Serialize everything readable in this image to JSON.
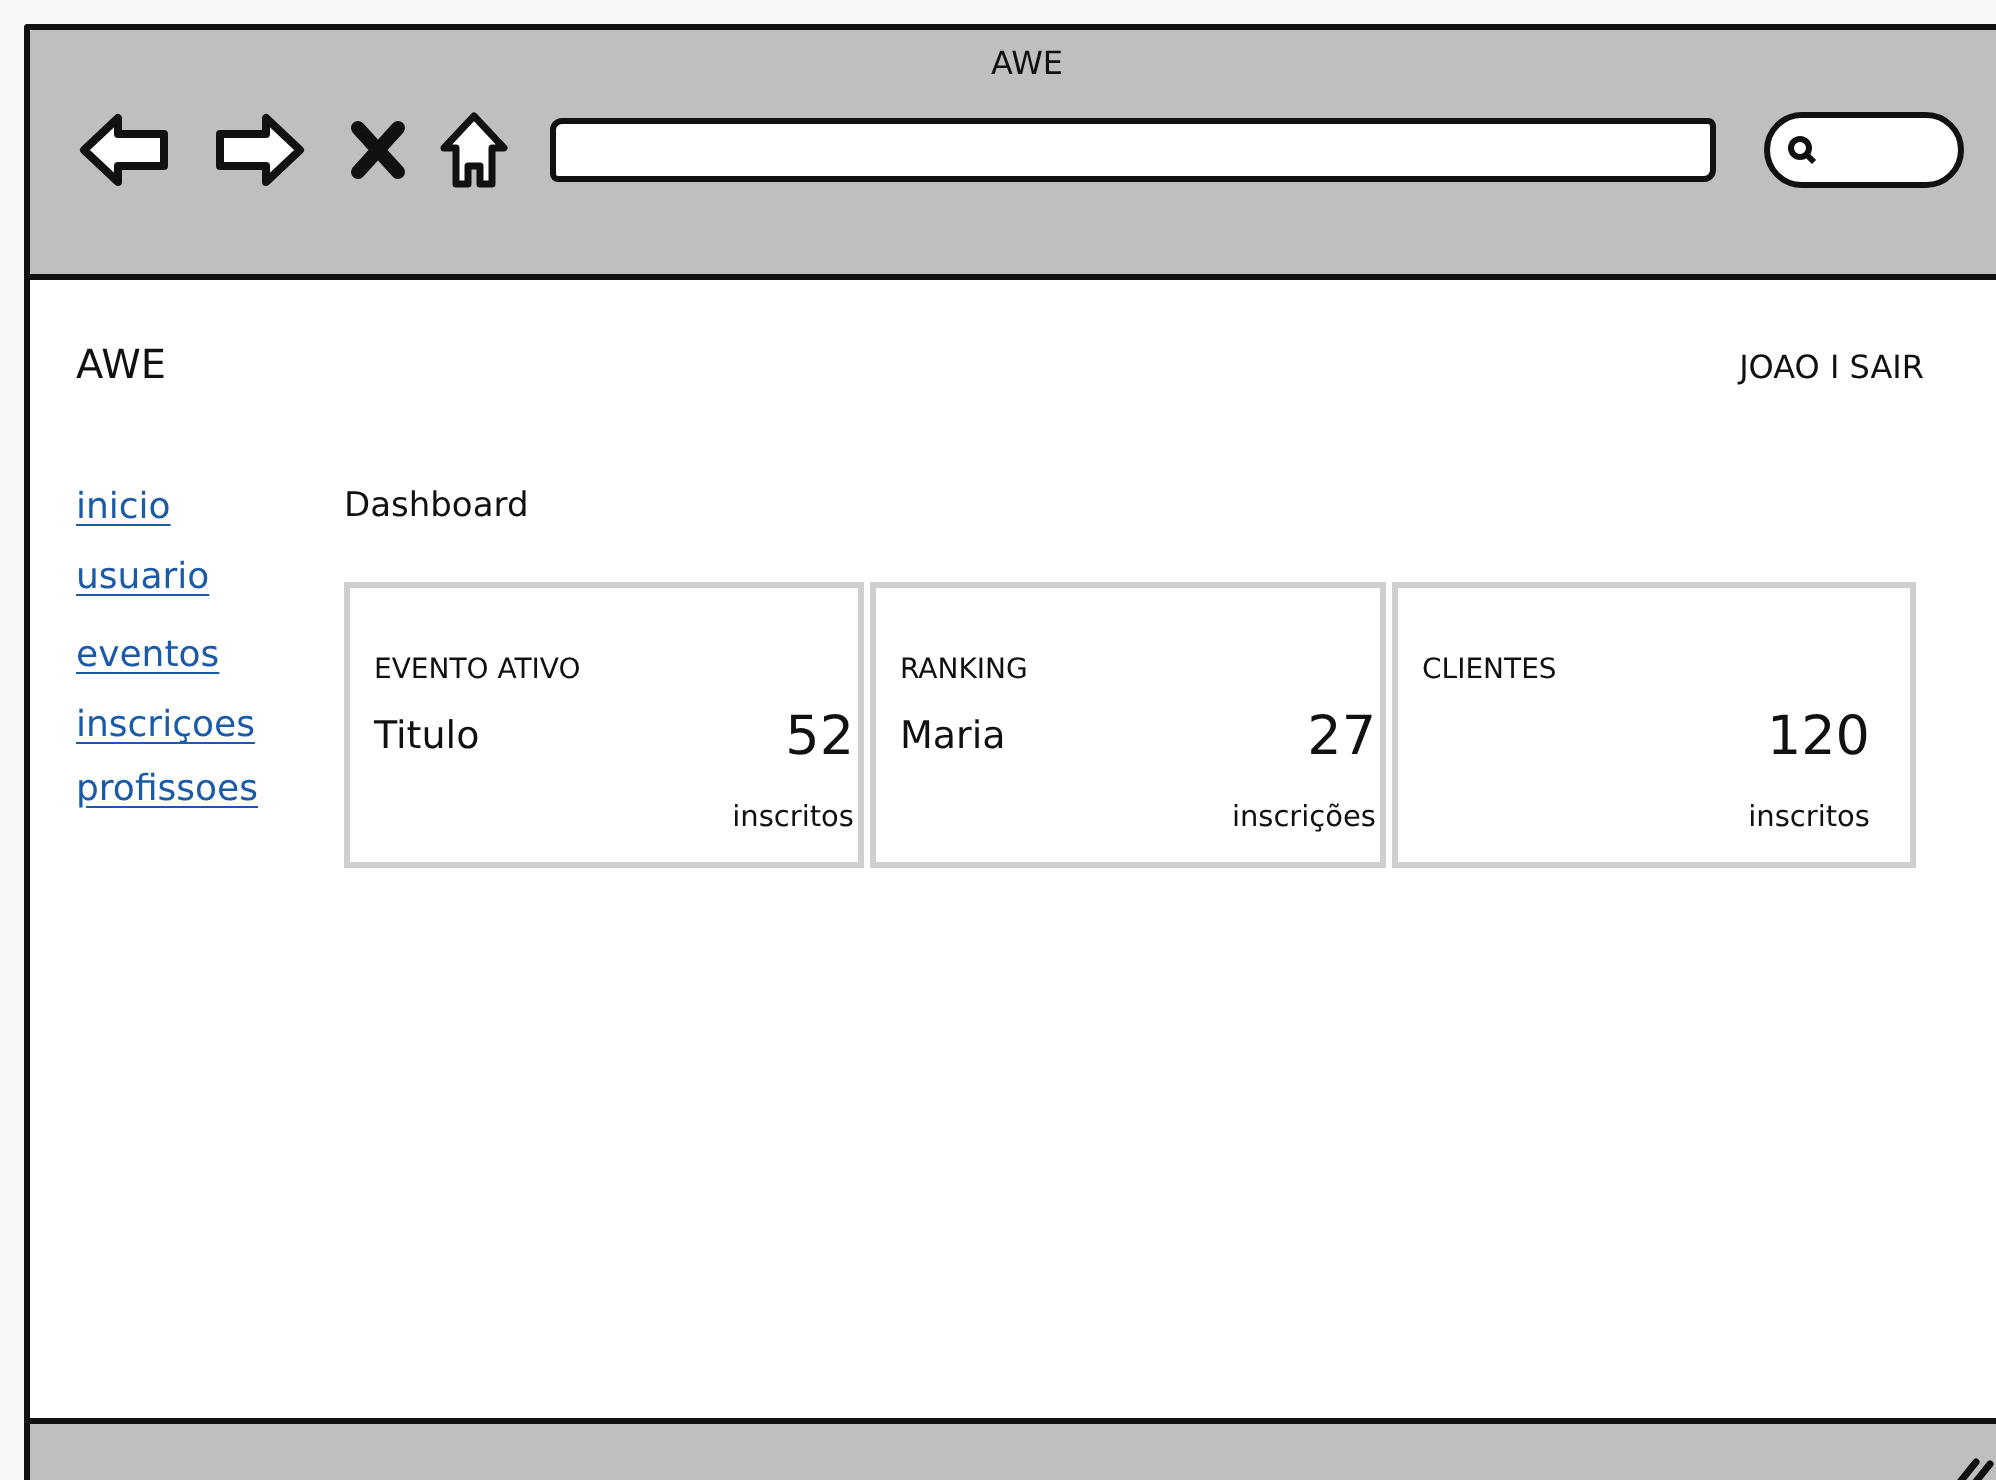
{
  "window": {
    "title": "AWE"
  },
  "header": {
    "logo": "AWE",
    "user": "JOAO I SAIR"
  },
  "sidebar": {
    "items": [
      {
        "label": "inicio"
      },
      {
        "label": "usuario"
      },
      {
        "label": "eventos"
      },
      {
        "label": "inscriçoes"
      },
      {
        "label": "profissoes"
      }
    ]
  },
  "page_title": "Dashboard",
  "cards": [
    {
      "heading": "EVENTO ATIVO",
      "subtitle": "Titulo",
      "value": "52",
      "unit": "inscritos"
    },
    {
      "heading": "RANKING",
      "subtitle": "Maria",
      "value": "27",
      "unit": "inscrições"
    },
    {
      "heading": "CLIENTES",
      "value": "120",
      "unit": "inscritos"
    }
  ]
}
